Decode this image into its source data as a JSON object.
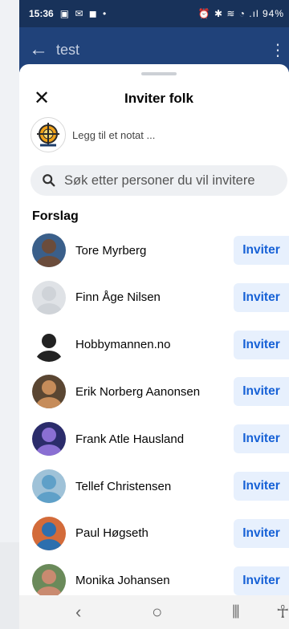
{
  "status_bar": {
    "time": "15:36",
    "left_icons": "▣ ✉ ◼ •",
    "right_icons": "⏰ ✱ ≋ ◔ .ıl 94%"
  },
  "app_bar": {
    "title": "test"
  },
  "sheet": {
    "title": "Inviter folk",
    "note_placeholder": "Legg til et notat ...",
    "search_placeholder": "Søk etter personer du vil invitere",
    "section_title": "Forslag",
    "invite_label": "Inviter",
    "people": [
      {
        "name": "Tore Myrberg",
        "avatar_color": "#6b4c3b",
        "avatar_bg": "#3a5f8a"
      },
      {
        "name": "Finn Åge Nilsen",
        "avatar_color": "#cfd3d8",
        "avatar_bg": "#dfe2e6"
      },
      {
        "name": "Hobbymannen.no",
        "avatar_color": "#222222",
        "avatar_bg": "#ffffff"
      },
      {
        "name": "Erik Norberg Aanonsen",
        "avatar_color": "#c68c5a",
        "avatar_bg": "#5a4632"
      },
      {
        "name": "Frank Atle Hausland",
        "avatar_color": "#8a6fd3",
        "avatar_bg": "#2b2c6b"
      },
      {
        "name": "Tellef Christensen",
        "avatar_color": "#5fa0c8",
        "avatar_bg": "#9fc2d8"
      },
      {
        "name": "Paul Høgseth",
        "avatar_color": "#2c6fae",
        "avatar_bg": "#d36b3a"
      },
      {
        "name": "Monika Johansen",
        "avatar_color": "#c98a70",
        "avatar_bg": "#6a8a5a"
      }
    ]
  },
  "colors": {
    "accent": "#1661d6",
    "invite_bg": "#e7f0fd",
    "app_bar": "#20427a",
    "status_bar": "#18325a"
  }
}
